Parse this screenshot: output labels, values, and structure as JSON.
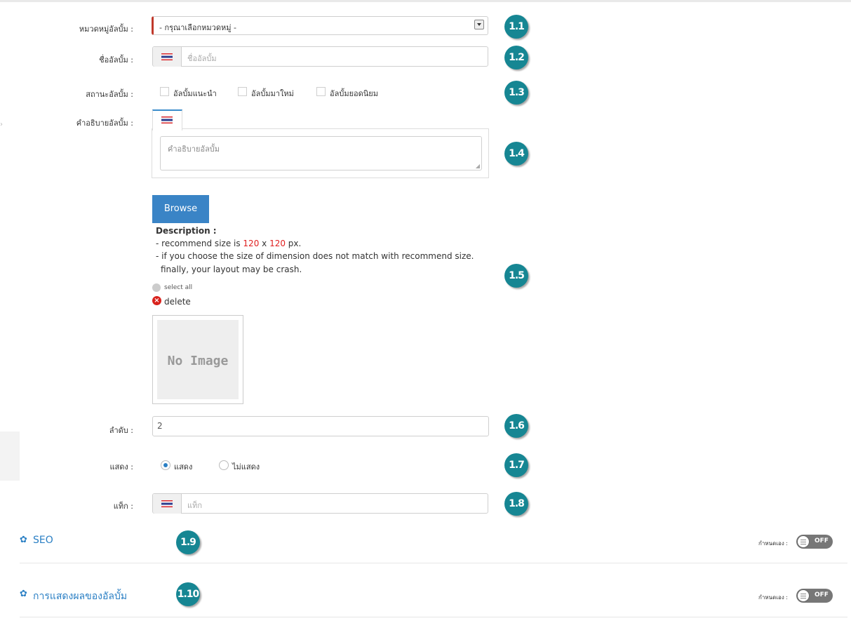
{
  "form": {
    "category": {
      "label": "หมวดหมู่อัลบั้ม :",
      "value": "- กรุณาเลือกหมวดหมู่ -"
    },
    "album_name": {
      "label": "ชื่ออัลบั้ม :",
      "placeholder": "ชื่ออัลบั้ม"
    },
    "status": {
      "label": "สถานะอัลบั้ม :",
      "options": [
        "อัลบั้มแนะนำ",
        "อัลบั้มมาใหม่",
        "อัลบั้มยอดนิยม"
      ]
    },
    "description": {
      "label": "คำอธิบายอัลบั้ม :",
      "placeholder": "คำอธิบายอัลบั้ม"
    },
    "image": {
      "browse_label": "Browse",
      "desc_title": "Description :",
      "desc_line1_pre": "- recommend size is ",
      "desc_w": "120",
      "desc_x": " x ",
      "desc_h": "120",
      "desc_line1_post": " px.",
      "desc_line2": "- if you choose the size of dimension does not match with recommend size.",
      "desc_line3": "finally, your layout may be crash.",
      "select_all": "select all",
      "delete": "delete",
      "no_image": "No Image"
    },
    "order": {
      "label": "ลำดับ :",
      "value": "2"
    },
    "display": {
      "label": "แสดง :",
      "options": [
        "แสดง",
        "ไม่แสดง"
      ],
      "selected": "แสดง"
    },
    "tag": {
      "label": "แท็ก :",
      "placeholder": "แท็ก"
    }
  },
  "sections": {
    "seo": {
      "title": "SEO",
      "custom_label": "กำหนดเอง :",
      "toggle": "OFF"
    },
    "album_display": {
      "title": "การแสดงผลของอัลบั้ม",
      "custom_label": "กำหนดเอง :",
      "toggle": "OFF"
    }
  },
  "badges": [
    "1.1",
    "1.2",
    "1.3",
    "1.4",
    "1.5",
    "1.6",
    "1.7",
    "1.8",
    "1.9",
    "1.10"
  ],
  "colors": {
    "accent": "#2a7fc4",
    "badge": "#168693",
    "button": "#3a84c6",
    "required": "#c0392b"
  }
}
